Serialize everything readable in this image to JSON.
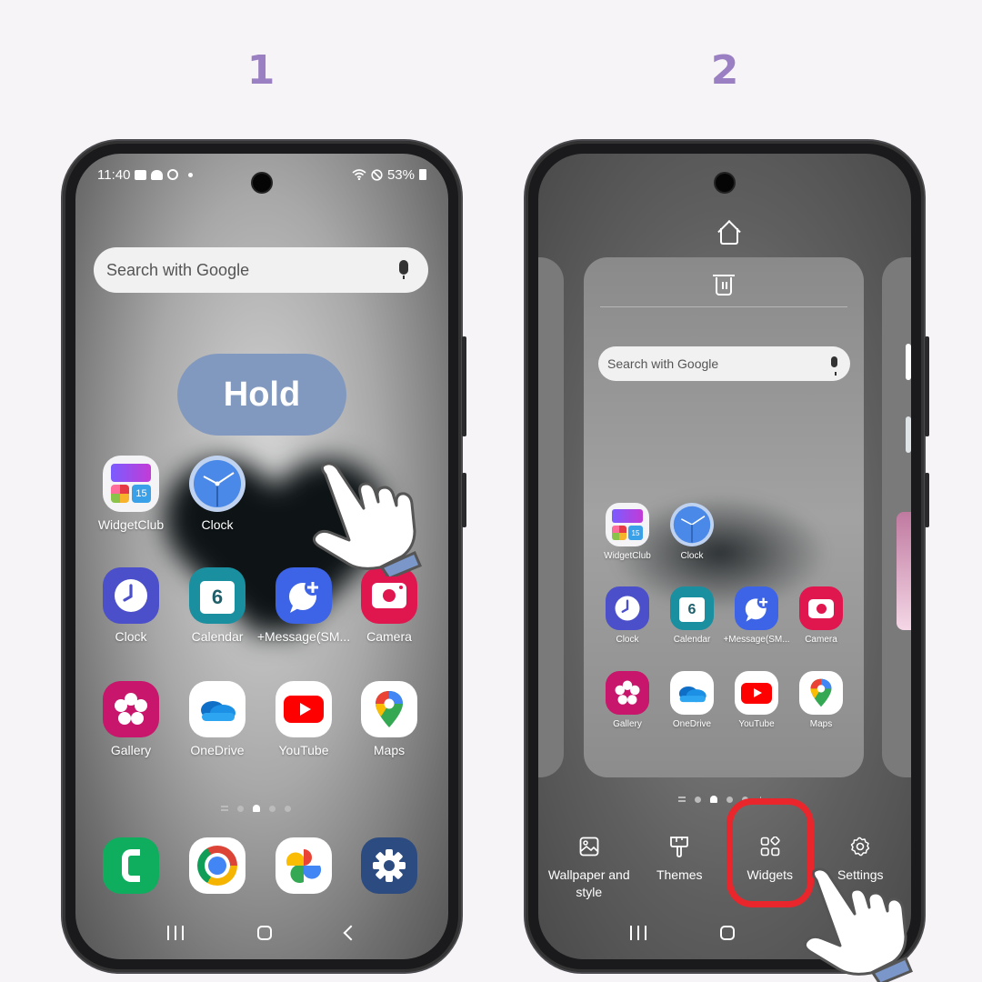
{
  "steps": [
    {
      "number": "1"
    },
    {
      "number": "2"
    }
  ],
  "colors": {
    "step_number": "#9a7fc2",
    "hold_pill": "#8299bf",
    "highlight": "#e8262c",
    "page_bg": "#f7f4f8"
  },
  "phone1": {
    "status_bar": {
      "time": "11:40",
      "left_icons": [
        "gallery-notification-icon",
        "weather-icon",
        "sync-icon",
        "dot-icon"
      ],
      "right_icons": [
        "wifi-icon",
        "do-not-disturb-icon",
        "battery-icon"
      ],
      "battery": "53%"
    },
    "search": {
      "placeholder": "Search with Google",
      "icon": "mic-icon"
    },
    "hold_label": "Hold",
    "apps_row1": [
      {
        "label": "WidgetClub",
        "icon": "widgetclub-icon"
      },
      {
        "label": "Clock",
        "icon": "clock-analog-icon"
      }
    ],
    "apps_row2": [
      {
        "label": "Clock",
        "icon": "clock-icon"
      },
      {
        "label": "Calendar",
        "icon": "calendar-icon",
        "badge": "6"
      },
      {
        "label": "+Message(SM...",
        "icon": "message-icon"
      },
      {
        "label": "Camera",
        "icon": "camera-icon"
      }
    ],
    "apps_row3": [
      {
        "label": "Gallery",
        "icon": "gallery-icon"
      },
      {
        "label": "OneDrive",
        "icon": "onedrive-icon"
      },
      {
        "label": "YouTube",
        "icon": "youtube-icon"
      },
      {
        "label": "Maps",
        "icon": "maps-icon"
      }
    ],
    "dock": [
      {
        "icon": "phone-icon"
      },
      {
        "icon": "chrome-icon"
      },
      {
        "icon": "photos-icon"
      },
      {
        "icon": "settings-icon"
      }
    ],
    "page_indicator": {
      "pages": 4,
      "current": "home"
    }
  },
  "phone2": {
    "search": {
      "placeholder": "Search with Google"
    },
    "apps_row1": [
      {
        "label": "WidgetClub"
      },
      {
        "label": "Clock"
      }
    ],
    "apps_row2": [
      {
        "label": "Clock"
      },
      {
        "label": "Calendar",
        "badge": "6"
      },
      {
        "label": "+Message(SM..."
      },
      {
        "label": "Camera"
      }
    ],
    "apps_row3": [
      {
        "label": "Gallery"
      },
      {
        "label": "OneDrive"
      },
      {
        "label": "YouTube"
      },
      {
        "label": "Maps"
      }
    ],
    "edit_menu": [
      {
        "label": "Wallpaper and style",
        "icon": "wallpaper-icon"
      },
      {
        "label": "Themes",
        "icon": "themes-brush-icon"
      },
      {
        "label": "Widgets",
        "icon": "widgets-icon"
      },
      {
        "label": "Settings",
        "icon": "settings-gear-icon"
      }
    ],
    "highlighted_item": "Widgets"
  }
}
